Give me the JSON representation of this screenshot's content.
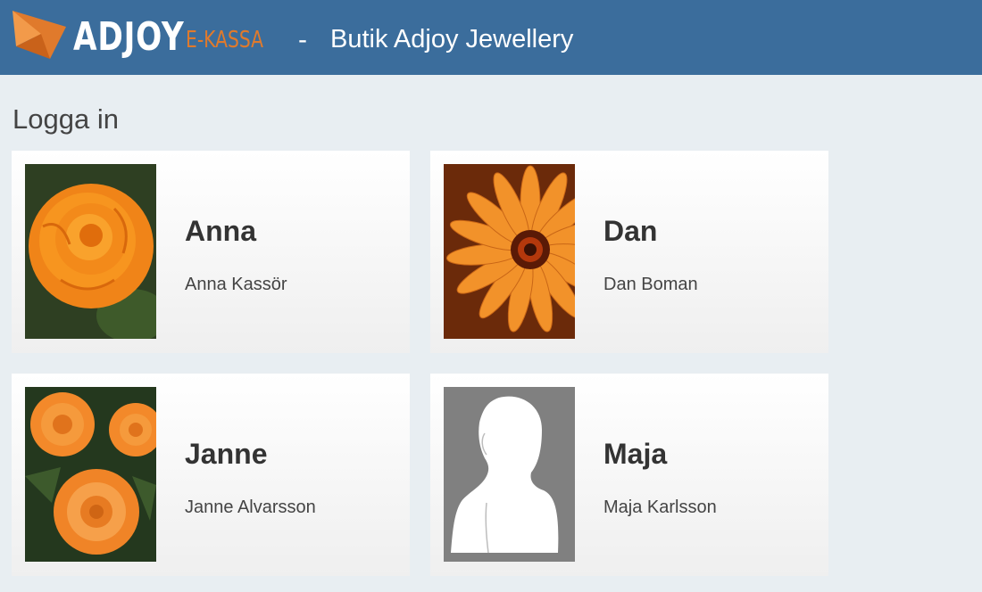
{
  "header": {
    "logo_text": "ADJOY",
    "logo_sub": "E-KASSA",
    "separator": "-",
    "store_name": "Butik Adjoy Jewellery",
    "background_color": "#3b6d9c",
    "accent_color": "#e07a2c"
  },
  "page": {
    "title": "Logga in"
  },
  "users": [
    {
      "name": "Anna",
      "full_name": "Anna Kassör",
      "avatar": "orange-begonia-flower"
    },
    {
      "name": "Dan",
      "full_name": "Dan Boman",
      "avatar": "orange-daisy-flower"
    },
    {
      "name": "Janne",
      "full_name": "Janne Alvarsson",
      "avatar": "orange-roses"
    },
    {
      "name": "Maja",
      "full_name": "Maja Karlsson",
      "avatar": "default-person-silhouette"
    }
  ]
}
